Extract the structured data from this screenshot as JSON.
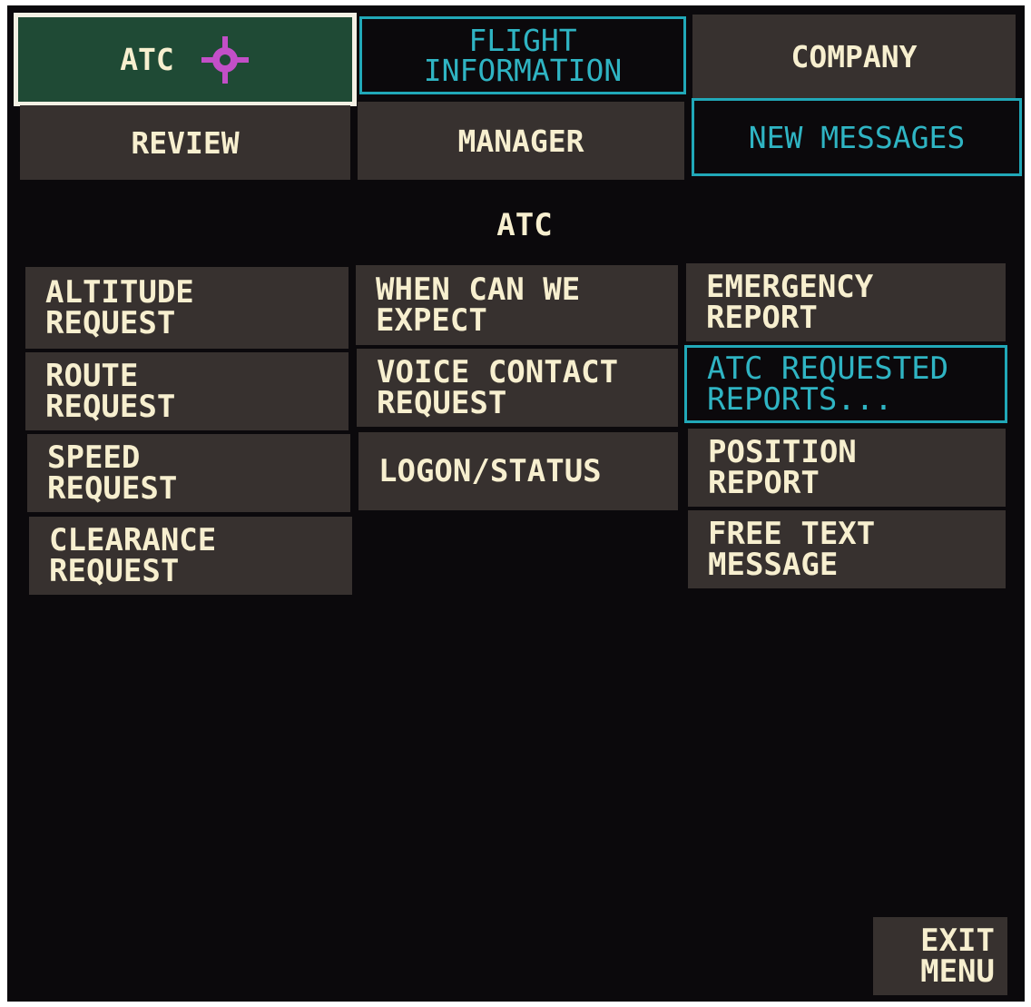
{
  "tabs": {
    "atc": "ATC",
    "flight_information": [
      "FLIGHT",
      "INFORMATION"
    ],
    "company": "COMPANY",
    "review": "REVIEW",
    "manager": "MANAGER",
    "new_messages": "NEW MESSAGES"
  },
  "section_title": "ATC",
  "menu": {
    "col1": [
      [
        "ALTITUDE",
        "REQUEST"
      ],
      [
        "ROUTE",
        "REQUEST"
      ],
      [
        "SPEED",
        "REQUEST"
      ],
      [
        "CLEARANCE",
        "REQUEST"
      ]
    ],
    "col2": [
      [
        "WHEN CAN WE",
        "EXPECT"
      ],
      [
        "VOICE CONTACT",
        "REQUEST"
      ],
      [
        "LOGON/STATUS"
      ]
    ],
    "col3": [
      [
        "EMERGENCY",
        "REPORT"
      ],
      [
        "ATC REQUESTED",
        "REPORTS..."
      ],
      [
        "POSITION",
        "REPORT"
      ],
      [
        "FREE TEXT",
        "MESSAGE"
      ]
    ]
  },
  "exit": [
    "EXIT",
    "MENU"
  ],
  "icons": {
    "selected_tab_marker": "crosshair-icon"
  },
  "colors": {
    "background": "#0b090c",
    "button": "#37312f",
    "text": "#f7efcf",
    "cyan": "#2fb4c3",
    "selected": "#1f4a35",
    "reticle": "#c24fc7"
  }
}
